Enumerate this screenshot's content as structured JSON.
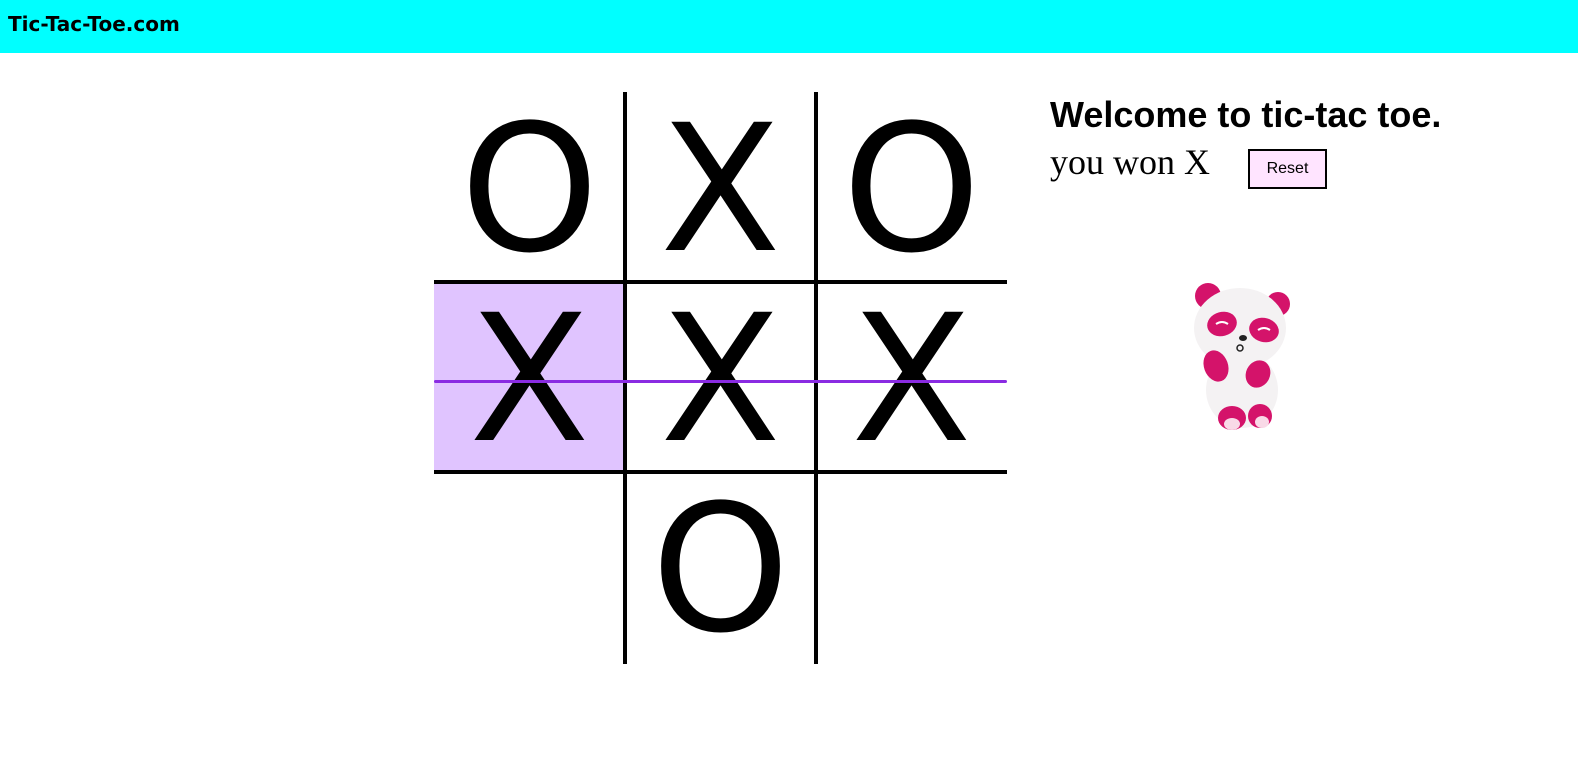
{
  "header": {
    "title": "Tic-Tac-Toe.com",
    "background": "#00ffff"
  },
  "board": {
    "cells": [
      "O",
      "X",
      "O",
      "X",
      "X",
      "X",
      "",
      "O",
      ""
    ],
    "winning_row": 2,
    "winning_line_color": "#8a2be2",
    "highlight_color": "#e0c4ff"
  },
  "sidebar": {
    "welcome": "Welcome to tic-tac toe.",
    "status": "you won X",
    "reset_label": "Reset",
    "reset_color": "#ffe4ff",
    "mascot_icon": "panda-mascot-icon"
  }
}
